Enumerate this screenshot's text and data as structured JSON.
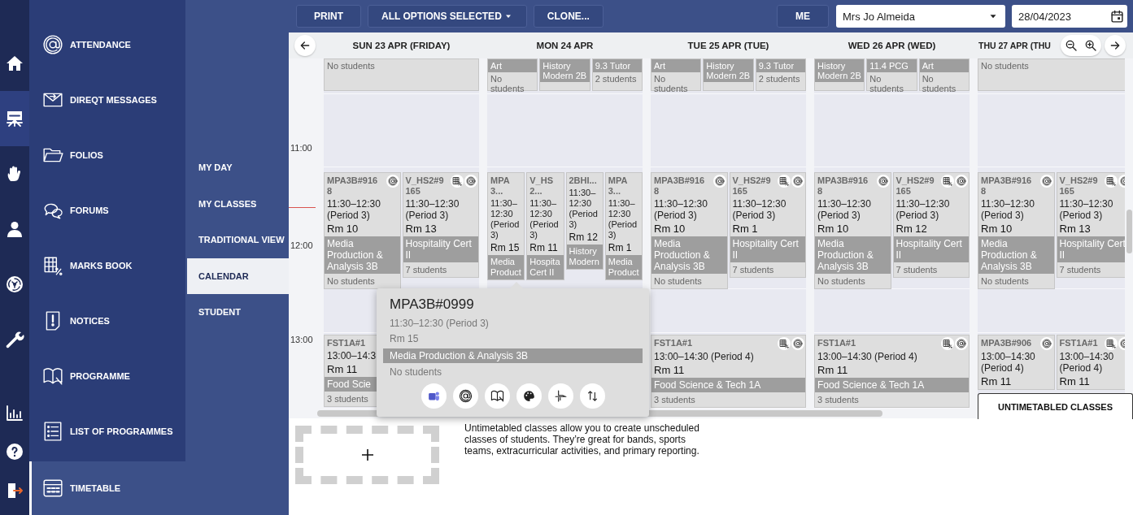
{
  "rail": [
    {
      "kind": "home",
      "selected": false
    },
    {
      "kind": "board",
      "selected": true
    },
    {
      "kind": "hand",
      "selected": false
    },
    {
      "kind": "person",
      "selected": false
    },
    {
      "kind": "swirl",
      "selected": false
    },
    {
      "kind": "wrench",
      "selected": false
    },
    {
      "kind": "chart",
      "selected": false
    },
    {
      "kind": "help",
      "selected": false
    },
    {
      "kind": "exit",
      "selected": false
    }
  ],
  "menu": [
    {
      "kind": "attendance",
      "label": "ATTENDANCE",
      "selected": false
    },
    {
      "kind": "messages",
      "label": "DIREQT MESSAGES",
      "selected": false
    },
    {
      "kind": "folios",
      "label": "FOLIOS",
      "selected": false
    },
    {
      "kind": "forums",
      "label": "FORUMS",
      "selected": false
    },
    {
      "kind": "marks",
      "label": "MARKS BOOK",
      "selected": false
    },
    {
      "kind": "notices",
      "label": "NOTICES",
      "selected": false
    },
    {
      "kind": "programme",
      "label": "PROGRAMME",
      "selected": false
    },
    {
      "kind": "list",
      "label": "LIST OF PROGRAMMES",
      "selected": false
    }
  ],
  "section": {
    "kind": "timetable",
    "label": "TIMETABLE",
    "selected": true
  },
  "submenu": [
    {
      "label": "MY DAY",
      "selected": false
    },
    {
      "label": "MY CLASSES",
      "selected": false
    },
    {
      "label": "TRADITIONAL VIEW",
      "selected": false
    },
    {
      "label": "CALENDAR",
      "selected": true
    },
    {
      "label": "STUDENT",
      "selected": false
    }
  ],
  "toolbar": {
    "buttons": [
      {
        "label": "PRINT",
        "dropdown": false
      },
      {
        "label": "ALL OPTIONS SELECTED",
        "dropdown": true
      },
      {
        "label": "CLONE...",
        "dropdown": false
      }
    ],
    "me_button": "ME",
    "teacher_select": {
      "value": "Mrs Jo Almeida"
    },
    "date_field": {
      "value": "28/04/2023"
    }
  },
  "calendar": {
    "time_labels": [
      "11:00",
      "12:00",
      "13:00"
    ],
    "days": [
      {
        "label": "SUN 23 APR (FRIDAY)",
        "top": [
          {
            "footer": "No students"
          }
        ],
        "period_3": [
          {
            "code": "MPA3B#9168",
            "time": "11:30–12:30 (Period 3)",
            "room": "Rm 10",
            "subject": "Media Production & Analysis 3B",
            "footer": "No students",
            "actions": [
              {
                "kind": "attendance"
              }
            ]
          },
          {
            "code": "V_HS2#9165",
            "time": "11:30–12:30 (Period 3)",
            "room": "Rm 13",
            "subject": "Hospitality Cert II",
            "footer": "7 students",
            "actions": [
              {
                "kind": "marks"
              },
              {
                "kind": "attendance"
              }
            ]
          }
        ],
        "period_4": [
          {
            "code": "FST1A#1",
            "time": "13:00–14:3",
            "room": "Rm 11",
            "subject": "Food Scie",
            "footer": "3 students"
          }
        ]
      },
      {
        "label": "MON 24 APR",
        "top": [
          {
            "subject": "Art",
            "footer": "No students"
          },
          {
            "subject": "History Modern 2B"
          },
          {
            "subject": "9.3 Tutor",
            "footer": "2 students"
          }
        ],
        "period_3": [
          {
            "code": "MPA3...",
            "time": "11:30–12:30 (Period 3)",
            "room": "Rm 15",
            "subject": "Media Product"
          },
          {
            "code": "V_HS2...",
            "time": "11:30–12:30 (Period 3)",
            "room": "Rm 11",
            "subject": "Hospita Cert II"
          },
          {
            "code": "2BHI...",
            "time": "11:30–12:30 (Period 3)",
            "room": "Rm 12",
            "subject": "History Modern"
          },
          {
            "code": "MPA3...",
            "time": "11:30–12:30 (Period 3)",
            "room": "Rm 1",
            "subject": "Media Product"
          }
        ]
      },
      {
        "label": "TUE 25 APR (TUE)",
        "top": [
          {
            "subject": "Art",
            "footer": "No students"
          },
          {
            "subject": "History Modern 2B"
          },
          {
            "subject": "9.3 Tutor",
            "footer": "2 students"
          }
        ],
        "period_3": [
          {
            "code": "MPA3B#9168",
            "time": "11:30–12:30 (Period 3)",
            "room": "Rm 10",
            "subject": "Media Production & Analysis 3B",
            "footer": "No students",
            "actions": [
              {
                "kind": "attendance"
              }
            ]
          },
          {
            "code": "V_HS2#9165",
            "time": "11:30–12:30 (Period 3)",
            "room": "Rm 1",
            "subject": "Hospitality Cert II",
            "footer": "7 students",
            "actions": [
              {
                "kind": "marks"
              },
              {
                "kind": "attendance"
              }
            ]
          }
        ],
        "period_4": [
          {
            "code": "FST1A#1",
            "time": "13:00–14:30 (Period 4)",
            "room": "Rm 11",
            "subject": "Food Science & Tech 1A",
            "footer": "3 students",
            "actions": [
              {
                "kind": "marks"
              },
              {
                "kind": "attendance"
              }
            ]
          }
        ]
      },
      {
        "label": "WED 26 APR (WED)",
        "top": [
          {
            "subject": "History Modern 2B"
          },
          {
            "subject": "11.4 PCG",
            "footer": "No students"
          },
          {
            "subject": "Art",
            "footer": "No students"
          }
        ],
        "period_3": [
          {
            "code": "MPA3B#9168",
            "time": "11:30–12:30 (Period 3)",
            "room": "Rm 10",
            "subject": "Media Production & Analysis 3B",
            "footer": "No students",
            "actions": [
              {
                "kind": "attendance"
              }
            ]
          },
          {
            "code": "V_HS2#9165",
            "time": "11:30–12:30 (Period 3)",
            "room": "Rm 12",
            "subject": "Hospitality Cert II",
            "footer": "7 students",
            "actions": [
              {
                "kind": "marks"
              },
              {
                "kind": "attendance"
              }
            ]
          }
        ],
        "period_4": [
          {
            "code": "FST1A#1",
            "time": "13:00–14:30 (Period 4)",
            "room": "Rm 11",
            "subject": "Food Science & Tech 1A",
            "footer": "3 students",
            "actions": [
              {
                "kind": "marks"
              },
              {
                "kind": "attendance"
              }
            ]
          }
        ]
      },
      {
        "label": "THU 27 APR (THU",
        "top": [
          {
            "footer": "No students"
          }
        ],
        "period_3": [
          {
            "code": "MPA3B#9168",
            "time": "11:30–12:30 (Period 3)",
            "room": "Rm 10",
            "subject": "Media Production & Analysis 3B",
            "footer": "No students",
            "actions": [
              {
                "kind": "attendance"
              }
            ]
          },
          {
            "code": "V_HS2#9165",
            "time": "11:30–12:30 (Period 3)",
            "room": "Rm 13",
            "subject": "Hospitality Cert II",
            "footer": "7 students",
            "actions": [
              {
                "kind": "marks"
              },
              {
                "kind": "attendance"
              }
            ]
          }
        ],
        "period_4": [
          {
            "code": "MPA3B#906",
            "time": "13:00–14:30 (Period 4)",
            "room": "Rm 11",
            "actions": [
              {
                "kind": "attendance"
              }
            ]
          },
          {
            "code": "FST1A#1",
            "time": "13:00–14:30 (Period 4)",
            "room": "Rm 11",
            "actions": [
              {
                "kind": "marks"
              },
              {
                "kind": "attendance"
              }
            ]
          }
        ]
      }
    ]
  },
  "popup": {
    "code": "MPA3B#0999",
    "time": "11:30–12:30 (Period 3)",
    "room": "Rm 15",
    "subject": "Media Production & Analysis 3B",
    "footer": "No students",
    "actions": [
      {
        "kind": "teams"
      },
      {
        "kind": "attendance"
      },
      {
        "kind": "programme"
      },
      {
        "kind": "palette"
      },
      {
        "kind": "tool"
      },
      {
        "kind": "swap"
      }
    ]
  },
  "untimetabled_tab": {
    "label": "UNTIMETABLED CLASSES"
  },
  "untimetabled_panel": {
    "text": "Untimetabled classes allow you to create unscheduled classes of students. They’re great for bands, sports teams, extracurricular activities, and primary reporting."
  }
}
